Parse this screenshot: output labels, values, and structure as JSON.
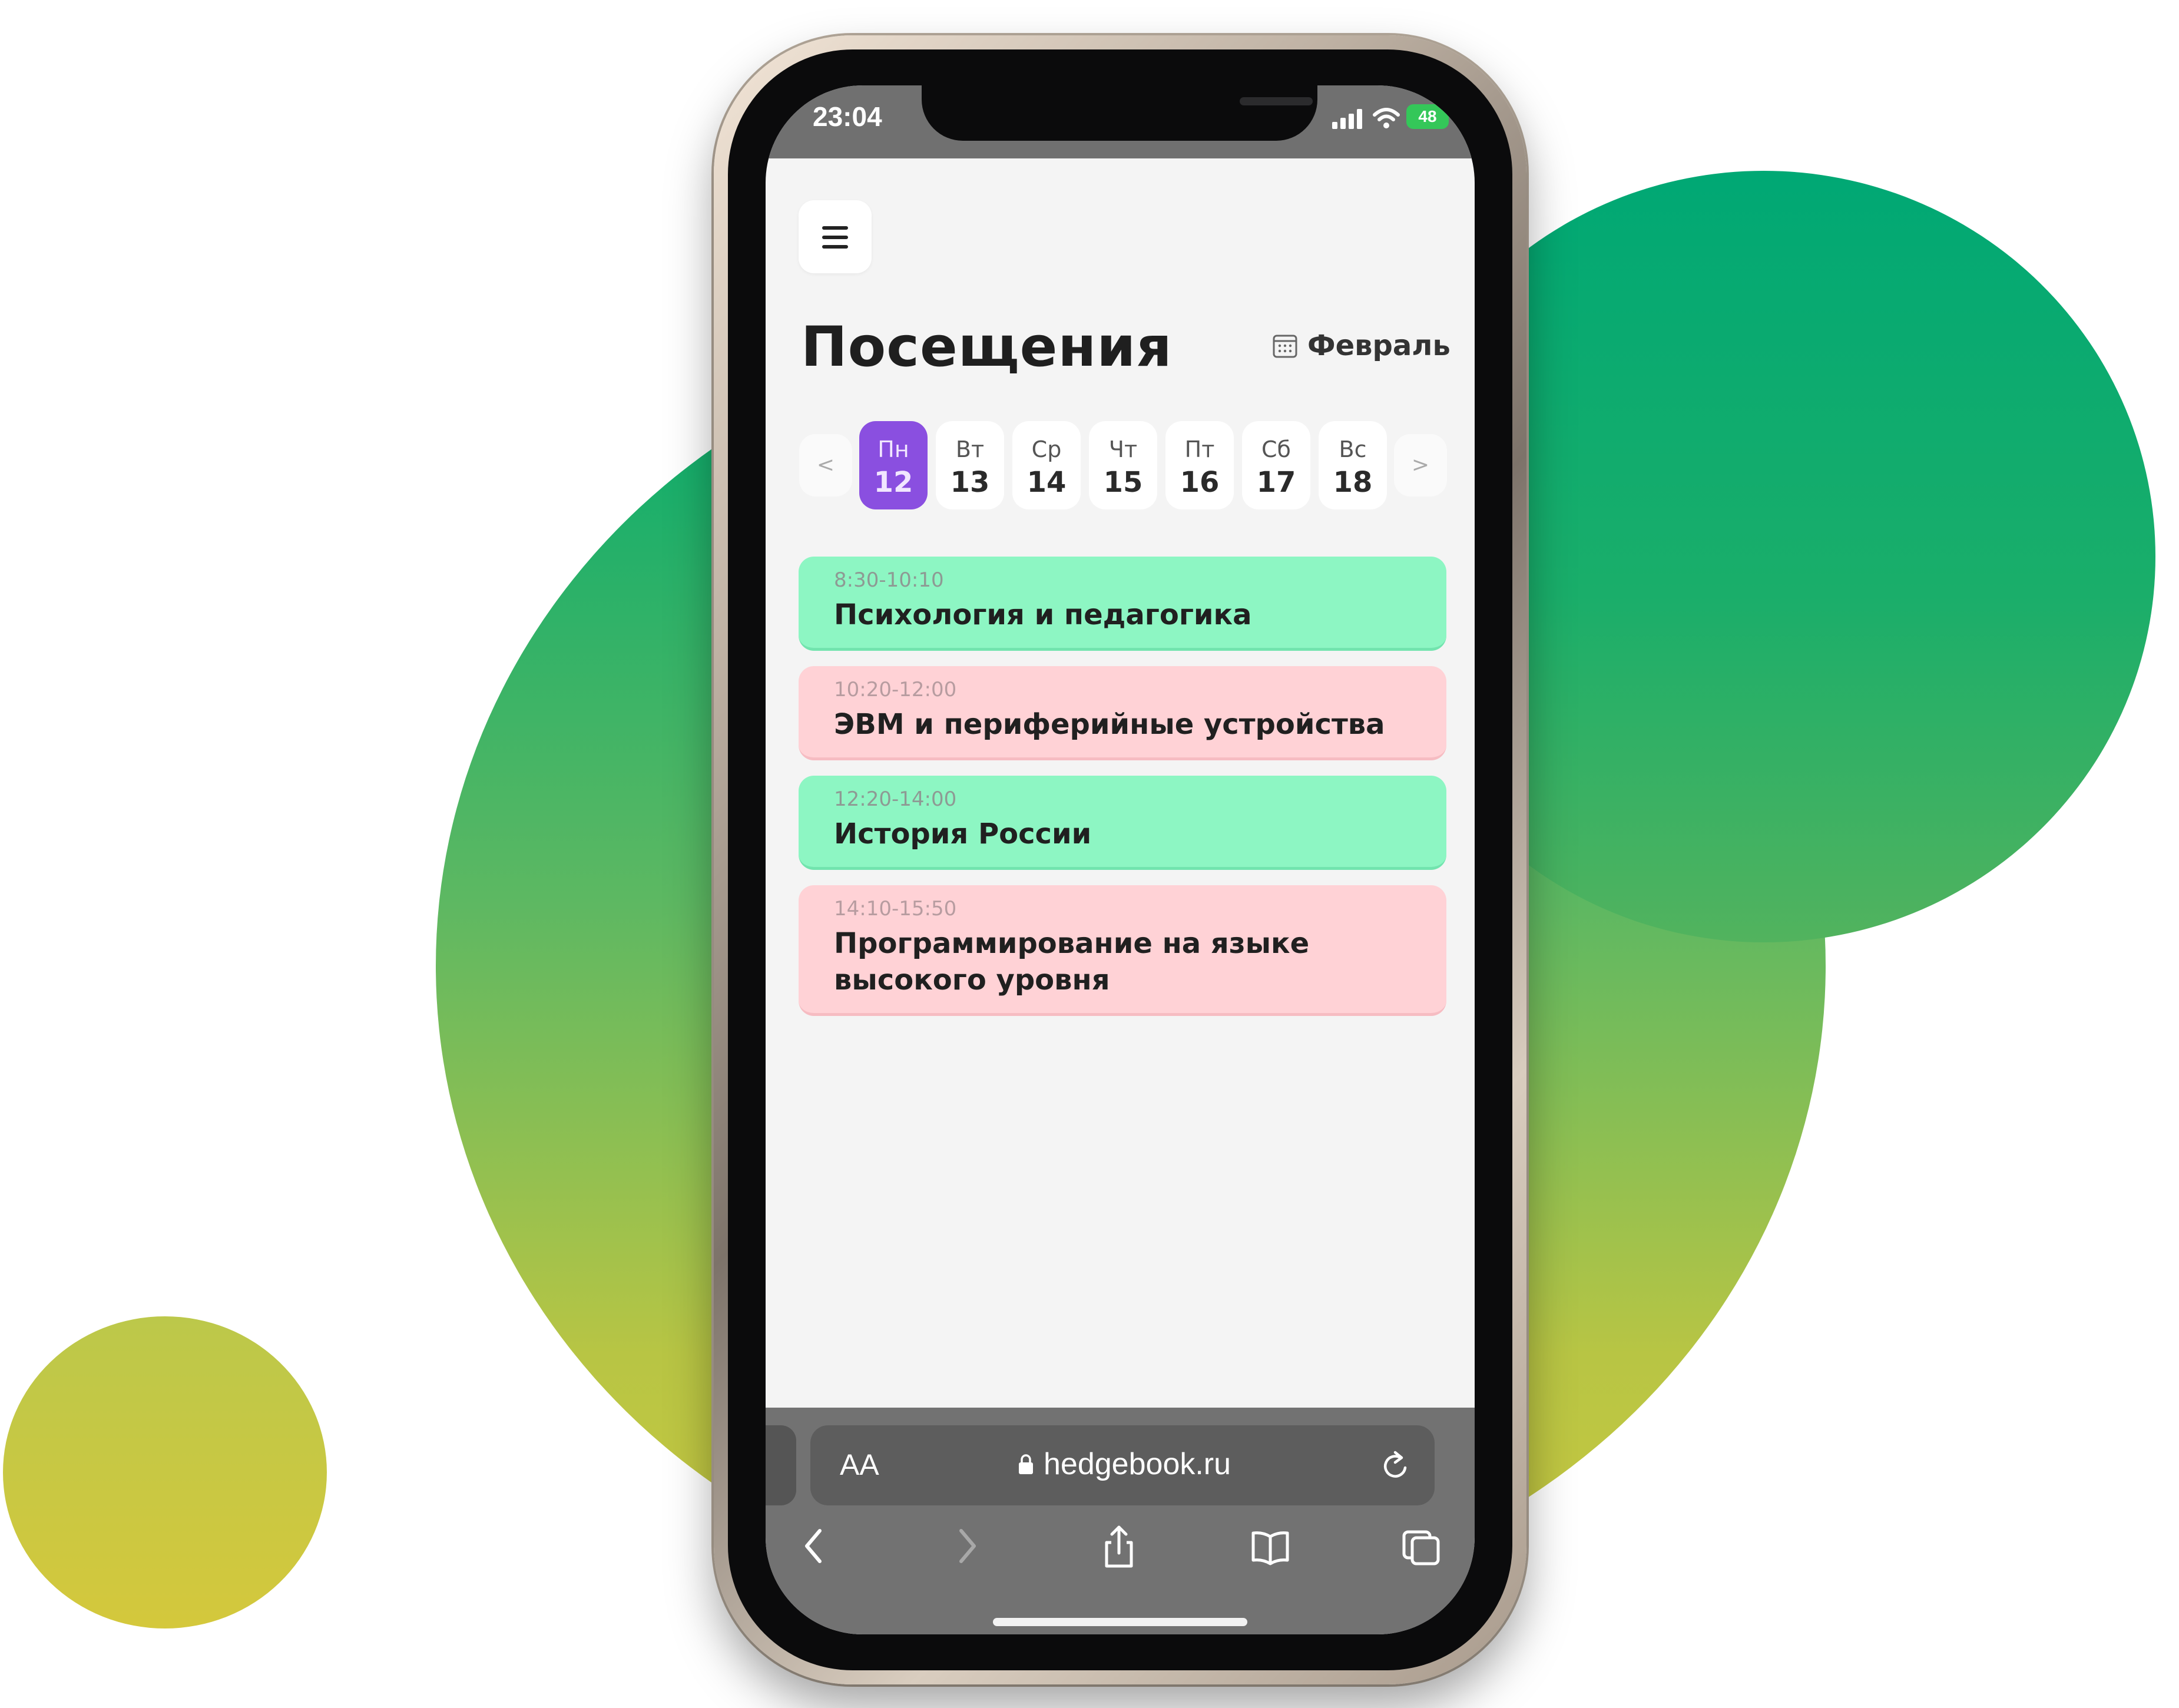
{
  "colors": {
    "accent": "#8a4fe0",
    "attended": "#8df6c3",
    "missed": "#ffd2d6",
    "brand_green": "#00ab6e"
  },
  "status_bar": {
    "time": "23:04",
    "battery": "48"
  },
  "header": {
    "menu_icon": "hamburger-icon",
    "title": "Посещения",
    "month_icon": "calendar-icon",
    "month": "Февраль"
  },
  "week": {
    "prev": "<",
    "next": ">",
    "days": [
      {
        "name": "Пн",
        "date": "12",
        "selected": true
      },
      {
        "name": "Вт",
        "date": "13",
        "selected": false
      },
      {
        "name": "Ср",
        "date": "14",
        "selected": false
      },
      {
        "name": "Чт",
        "date": "15",
        "selected": false
      },
      {
        "name": "Пт",
        "date": "16",
        "selected": false
      },
      {
        "name": "Сб",
        "date": "17",
        "selected": false
      },
      {
        "name": "Вс",
        "date": "18",
        "selected": false
      }
    ]
  },
  "lessons": [
    {
      "time": "8:30-10:10",
      "name": "Психология и педагогика",
      "status": "attended"
    },
    {
      "time": "10:20-12:00",
      "name": "ЭВМ и периферийные устройства",
      "status": "missed"
    },
    {
      "time": "12:20-14:00",
      "name": "История России",
      "status": "attended"
    },
    {
      "time": "14:10-15:50",
      "name": "Программирование на языке высокого уровня",
      "status": "missed"
    }
  ],
  "browser": {
    "text_size": "AA",
    "url": "hedgebook.ru",
    "icons": [
      "back-icon",
      "forward-icon",
      "share-icon",
      "bookmarks-icon",
      "tabs-icon"
    ]
  }
}
